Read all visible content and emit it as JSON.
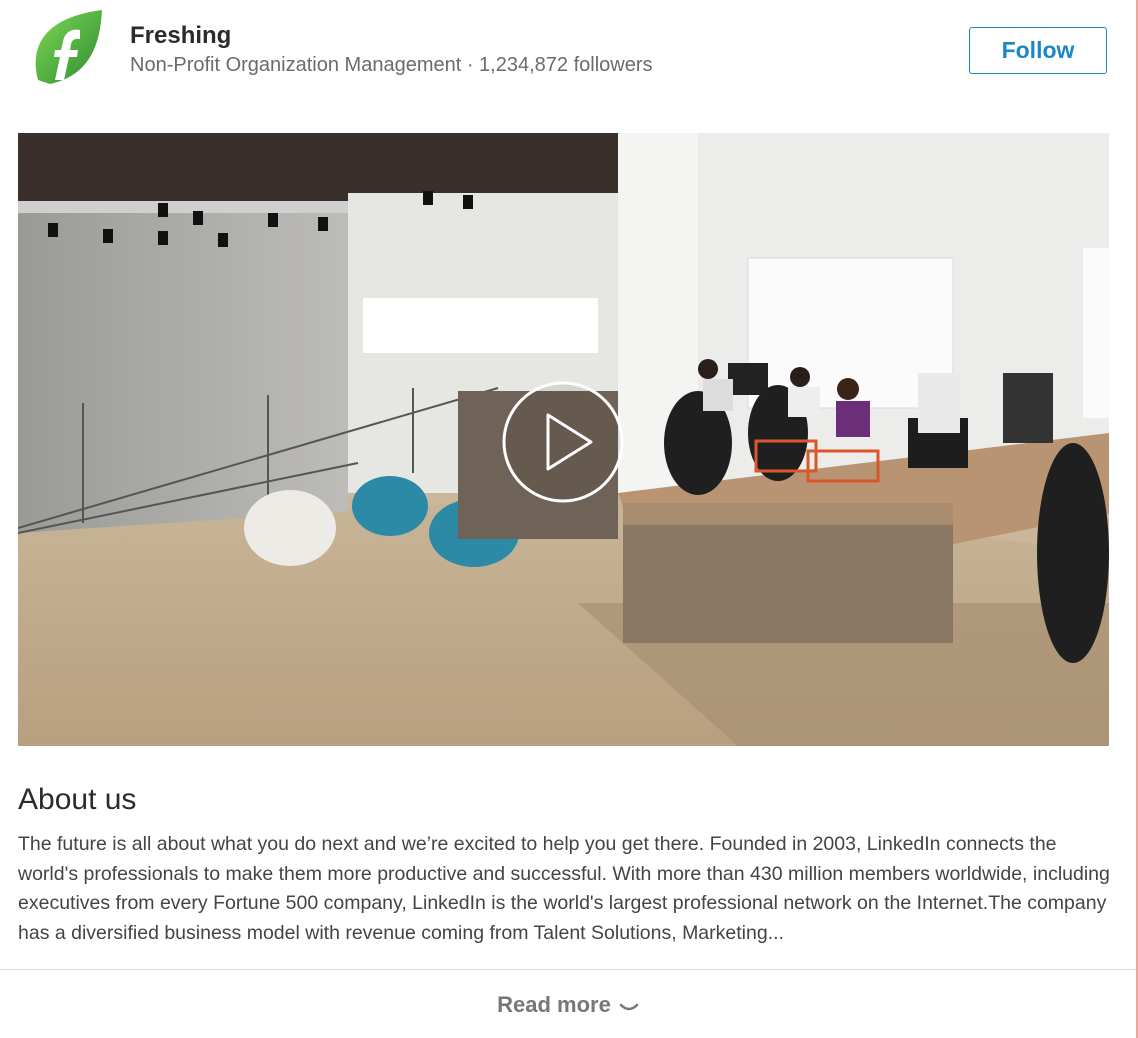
{
  "company": {
    "name": "Freshing",
    "meta": "Non-Profit Organization Management · 1,234,872 followers",
    "logo_icon": "leaf-f-logo",
    "brand_color": "#4caf35"
  },
  "follow_button": {
    "label": "Follow",
    "color": "#1d87c4"
  },
  "media": {
    "type": "video-thumbnail",
    "play_icon": "play-icon"
  },
  "about": {
    "title": "About us",
    "text": "The future is all about what you do next and we’re excited to help you get there. Founded in 2003, LinkedIn connects the world's professionals to make them more productive and successful. With more than 430 million members worldwide, including executives from every Fortune 500 company, LinkedIn is the world's largest professional network on the Internet.The company has a diversified business model with revenue coming from Talent Solutions, Marketing..."
  },
  "read_more": {
    "label": "Read more",
    "icon": "chevron-down-icon"
  }
}
